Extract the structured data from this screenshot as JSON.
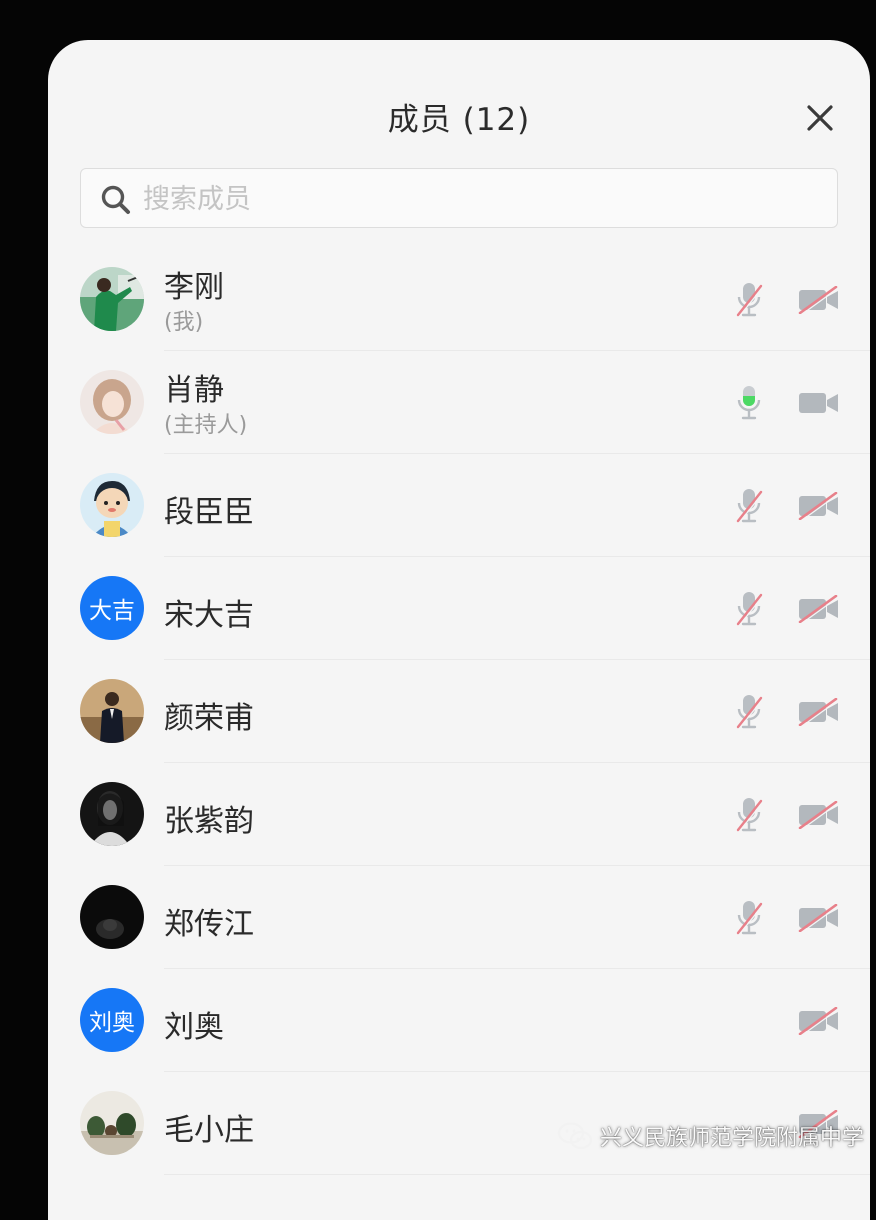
{
  "header": {
    "title": "成员 (12)"
  },
  "search": {
    "placeholder": "搜索成员"
  },
  "members": [
    {
      "name": "李刚",
      "sub": "(我)",
      "avatar": "photo-outdoor",
      "mic": "muted",
      "camera": "off"
    },
    {
      "name": "肖静",
      "sub": "(主持人)",
      "avatar": "photo-woman",
      "mic": "active",
      "camera": "on"
    },
    {
      "name": "段臣臣",
      "sub": "",
      "avatar": "cartoon-boy",
      "mic": "muted",
      "camera": "off"
    },
    {
      "name": "宋大吉",
      "sub": "",
      "avatar": "text",
      "avatar_text": "大吉",
      "mic": "muted",
      "camera": "off"
    },
    {
      "name": "颜荣甫",
      "sub": "",
      "avatar": "photo-suit",
      "mic": "muted",
      "camera": "off"
    },
    {
      "name": "张紫韵",
      "sub": "",
      "avatar": "photo-dark-portrait",
      "mic": "muted",
      "camera": "off"
    },
    {
      "name": "郑传江",
      "sub": "",
      "avatar": "photo-black",
      "mic": "muted",
      "camera": "off"
    },
    {
      "name": "刘奥",
      "sub": "",
      "avatar": "text",
      "avatar_text": "刘奥",
      "mic": "none",
      "camera": "off"
    },
    {
      "name": "毛小庄",
      "sub": "",
      "avatar": "photo-table",
      "mic": "none",
      "camera": "off"
    }
  ],
  "colors": {
    "accent": "#1677f6",
    "mic_active": "#4cd964",
    "muted_slash": "#e8808a",
    "icon_gray": "#9aa0a6"
  },
  "watermark": {
    "text": "兴义民族师范学院附属中学",
    "icon": "wechat-icon"
  }
}
